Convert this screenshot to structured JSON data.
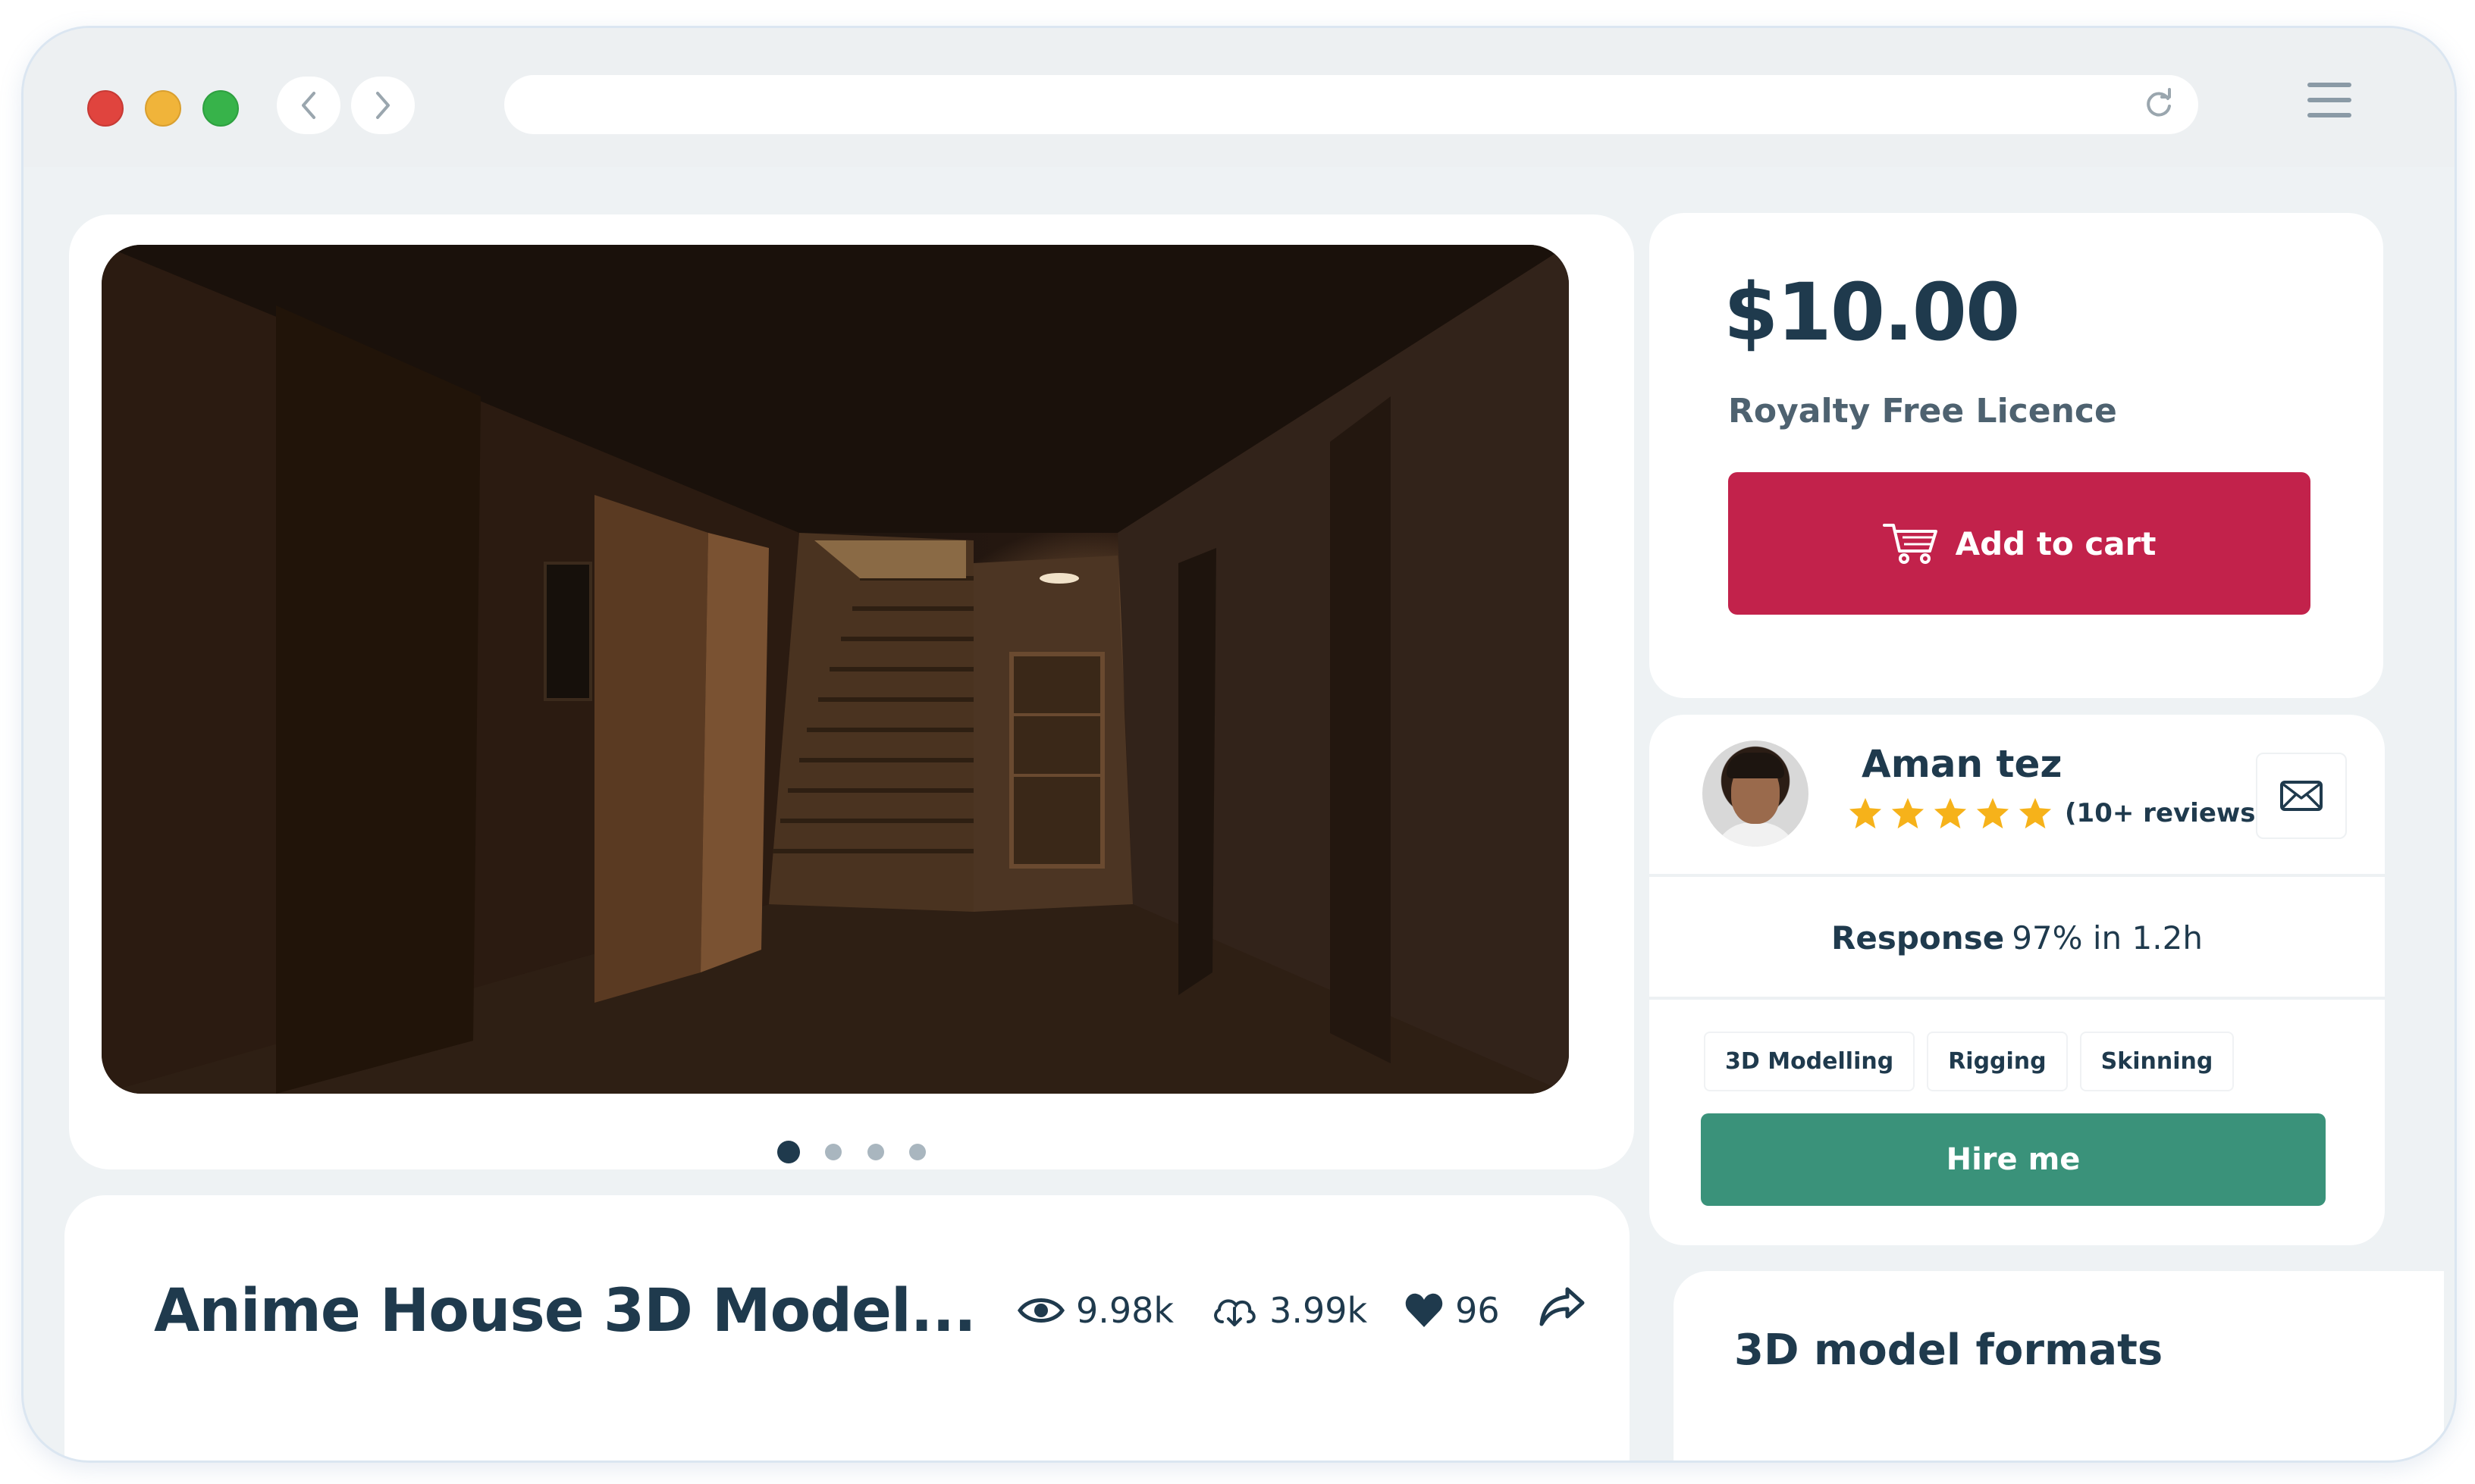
{
  "browser": {
    "back_icon": "chevron-left-icon",
    "forward_icon": "chevron-right-icon",
    "reload_icon": "reload-icon",
    "menu_icon": "hamburger-menu-icon",
    "url": ""
  },
  "gallery": {
    "image_alt": "",
    "slides": 4,
    "active_slide": 1
  },
  "product": {
    "title": "Anime House 3D Model...",
    "views": "9.98k",
    "downloads": "3.99k",
    "likes": "96"
  },
  "pricing": {
    "price": "$10.00",
    "licence": "Royalty Free Licence",
    "cart_label": "Add to cart"
  },
  "seller": {
    "name": "Aman tez",
    "rating": 5,
    "reviews": "(10+ reviews)",
    "response_label": "Response",
    "response_value": "97% in 1.2h",
    "skills": [
      "3D Modelling",
      "Rigging",
      "Skinning"
    ],
    "hire_label": "Hire me"
  },
  "formats": {
    "title": "3D model formats"
  },
  "colors": {
    "accent_red": "#c2224b",
    "accent_green": "#3a927a",
    "text_dark": "#1f3a4d",
    "star": "#f6b21a"
  }
}
